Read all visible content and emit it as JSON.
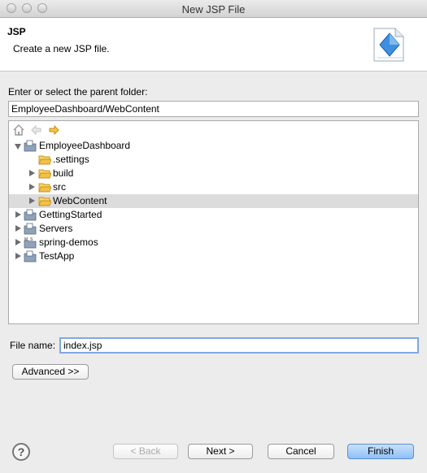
{
  "window": {
    "title": "New JSP File"
  },
  "header": {
    "title": "JSP",
    "description": "Create a new JSP file."
  },
  "parent_folder": {
    "label": "Enter or select the parent folder:",
    "value": "EmployeeDashboard/WebContent"
  },
  "tree": {
    "items": [
      {
        "label": "EmployeeDashboard",
        "icon": "project-icon",
        "expanded": true
      },
      {
        "label": ".settings",
        "icon": "folder-icon"
      },
      {
        "label": "build",
        "icon": "folder-icon"
      },
      {
        "label": "src",
        "icon": "folder-icon"
      },
      {
        "label": "WebContent",
        "icon": "folder-icon",
        "selected": true
      },
      {
        "label": "GettingStarted",
        "icon": "project-icon"
      },
      {
        "label": "Servers",
        "icon": "project-icon"
      },
      {
        "label": "spring-demos",
        "icon": "maven-project-icon"
      },
      {
        "label": "TestApp",
        "icon": "project-icon"
      }
    ]
  },
  "file_name": {
    "label": "File name:",
    "value": "index.jsp"
  },
  "buttons": {
    "advanced": "Advanced >>",
    "back": "< Back",
    "next": "Next >",
    "cancel": "Cancel",
    "finish": "Finish",
    "help": "?"
  },
  "colors": {
    "accent": "#5a8ed6",
    "selection": "#dcdcdc",
    "folder": "#f4c04a"
  }
}
